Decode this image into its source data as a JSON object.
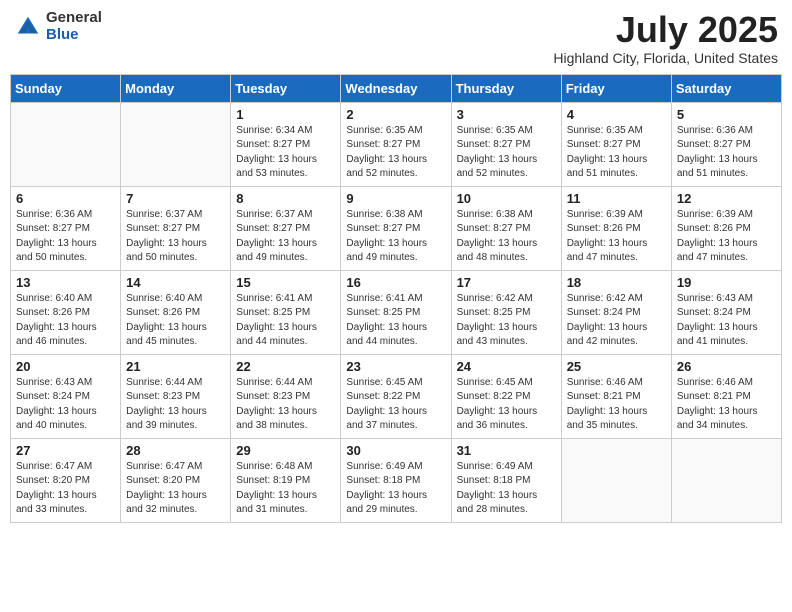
{
  "logo": {
    "general": "General",
    "blue": "Blue"
  },
  "title": "July 2025",
  "location": "Highland City, Florida, United States",
  "weekdays": [
    "Sunday",
    "Monday",
    "Tuesday",
    "Wednesday",
    "Thursday",
    "Friday",
    "Saturday"
  ],
  "weeks": [
    [
      {
        "day": "",
        "sunrise": "",
        "sunset": "",
        "daylight": ""
      },
      {
        "day": "",
        "sunrise": "",
        "sunset": "",
        "daylight": ""
      },
      {
        "day": "1",
        "sunrise": "Sunrise: 6:34 AM",
        "sunset": "Sunset: 8:27 PM",
        "daylight": "Daylight: 13 hours and 53 minutes."
      },
      {
        "day": "2",
        "sunrise": "Sunrise: 6:35 AM",
        "sunset": "Sunset: 8:27 PM",
        "daylight": "Daylight: 13 hours and 52 minutes."
      },
      {
        "day": "3",
        "sunrise": "Sunrise: 6:35 AM",
        "sunset": "Sunset: 8:27 PM",
        "daylight": "Daylight: 13 hours and 52 minutes."
      },
      {
        "day": "4",
        "sunrise": "Sunrise: 6:35 AM",
        "sunset": "Sunset: 8:27 PM",
        "daylight": "Daylight: 13 hours and 51 minutes."
      },
      {
        "day": "5",
        "sunrise": "Sunrise: 6:36 AM",
        "sunset": "Sunset: 8:27 PM",
        "daylight": "Daylight: 13 hours and 51 minutes."
      }
    ],
    [
      {
        "day": "6",
        "sunrise": "Sunrise: 6:36 AM",
        "sunset": "Sunset: 8:27 PM",
        "daylight": "Daylight: 13 hours and 50 minutes."
      },
      {
        "day": "7",
        "sunrise": "Sunrise: 6:37 AM",
        "sunset": "Sunset: 8:27 PM",
        "daylight": "Daylight: 13 hours and 50 minutes."
      },
      {
        "day": "8",
        "sunrise": "Sunrise: 6:37 AM",
        "sunset": "Sunset: 8:27 PM",
        "daylight": "Daylight: 13 hours and 49 minutes."
      },
      {
        "day": "9",
        "sunrise": "Sunrise: 6:38 AM",
        "sunset": "Sunset: 8:27 PM",
        "daylight": "Daylight: 13 hours and 49 minutes."
      },
      {
        "day": "10",
        "sunrise": "Sunrise: 6:38 AM",
        "sunset": "Sunset: 8:27 PM",
        "daylight": "Daylight: 13 hours and 48 minutes."
      },
      {
        "day": "11",
        "sunrise": "Sunrise: 6:39 AM",
        "sunset": "Sunset: 8:26 PM",
        "daylight": "Daylight: 13 hours and 47 minutes."
      },
      {
        "day": "12",
        "sunrise": "Sunrise: 6:39 AM",
        "sunset": "Sunset: 8:26 PM",
        "daylight": "Daylight: 13 hours and 47 minutes."
      }
    ],
    [
      {
        "day": "13",
        "sunrise": "Sunrise: 6:40 AM",
        "sunset": "Sunset: 8:26 PM",
        "daylight": "Daylight: 13 hours and 46 minutes."
      },
      {
        "day": "14",
        "sunrise": "Sunrise: 6:40 AM",
        "sunset": "Sunset: 8:26 PM",
        "daylight": "Daylight: 13 hours and 45 minutes."
      },
      {
        "day": "15",
        "sunrise": "Sunrise: 6:41 AM",
        "sunset": "Sunset: 8:25 PM",
        "daylight": "Daylight: 13 hours and 44 minutes."
      },
      {
        "day": "16",
        "sunrise": "Sunrise: 6:41 AM",
        "sunset": "Sunset: 8:25 PM",
        "daylight": "Daylight: 13 hours and 44 minutes."
      },
      {
        "day": "17",
        "sunrise": "Sunrise: 6:42 AM",
        "sunset": "Sunset: 8:25 PM",
        "daylight": "Daylight: 13 hours and 43 minutes."
      },
      {
        "day": "18",
        "sunrise": "Sunrise: 6:42 AM",
        "sunset": "Sunset: 8:24 PM",
        "daylight": "Daylight: 13 hours and 42 minutes."
      },
      {
        "day": "19",
        "sunrise": "Sunrise: 6:43 AM",
        "sunset": "Sunset: 8:24 PM",
        "daylight": "Daylight: 13 hours and 41 minutes."
      }
    ],
    [
      {
        "day": "20",
        "sunrise": "Sunrise: 6:43 AM",
        "sunset": "Sunset: 8:24 PM",
        "daylight": "Daylight: 13 hours and 40 minutes."
      },
      {
        "day": "21",
        "sunrise": "Sunrise: 6:44 AM",
        "sunset": "Sunset: 8:23 PM",
        "daylight": "Daylight: 13 hours and 39 minutes."
      },
      {
        "day": "22",
        "sunrise": "Sunrise: 6:44 AM",
        "sunset": "Sunset: 8:23 PM",
        "daylight": "Daylight: 13 hours and 38 minutes."
      },
      {
        "day": "23",
        "sunrise": "Sunrise: 6:45 AM",
        "sunset": "Sunset: 8:22 PM",
        "daylight": "Daylight: 13 hours and 37 minutes."
      },
      {
        "day": "24",
        "sunrise": "Sunrise: 6:45 AM",
        "sunset": "Sunset: 8:22 PM",
        "daylight": "Daylight: 13 hours and 36 minutes."
      },
      {
        "day": "25",
        "sunrise": "Sunrise: 6:46 AM",
        "sunset": "Sunset: 8:21 PM",
        "daylight": "Daylight: 13 hours and 35 minutes."
      },
      {
        "day": "26",
        "sunrise": "Sunrise: 6:46 AM",
        "sunset": "Sunset: 8:21 PM",
        "daylight": "Daylight: 13 hours and 34 minutes."
      }
    ],
    [
      {
        "day": "27",
        "sunrise": "Sunrise: 6:47 AM",
        "sunset": "Sunset: 8:20 PM",
        "daylight": "Daylight: 13 hours and 33 minutes."
      },
      {
        "day": "28",
        "sunrise": "Sunrise: 6:47 AM",
        "sunset": "Sunset: 8:20 PM",
        "daylight": "Daylight: 13 hours and 32 minutes."
      },
      {
        "day": "29",
        "sunrise": "Sunrise: 6:48 AM",
        "sunset": "Sunset: 8:19 PM",
        "daylight": "Daylight: 13 hours and 31 minutes."
      },
      {
        "day": "30",
        "sunrise": "Sunrise: 6:49 AM",
        "sunset": "Sunset: 8:18 PM",
        "daylight": "Daylight: 13 hours and 29 minutes."
      },
      {
        "day": "31",
        "sunrise": "Sunrise: 6:49 AM",
        "sunset": "Sunset: 8:18 PM",
        "daylight": "Daylight: 13 hours and 28 minutes."
      },
      {
        "day": "",
        "sunrise": "",
        "sunset": "",
        "daylight": ""
      },
      {
        "day": "",
        "sunrise": "",
        "sunset": "",
        "daylight": ""
      }
    ]
  ]
}
